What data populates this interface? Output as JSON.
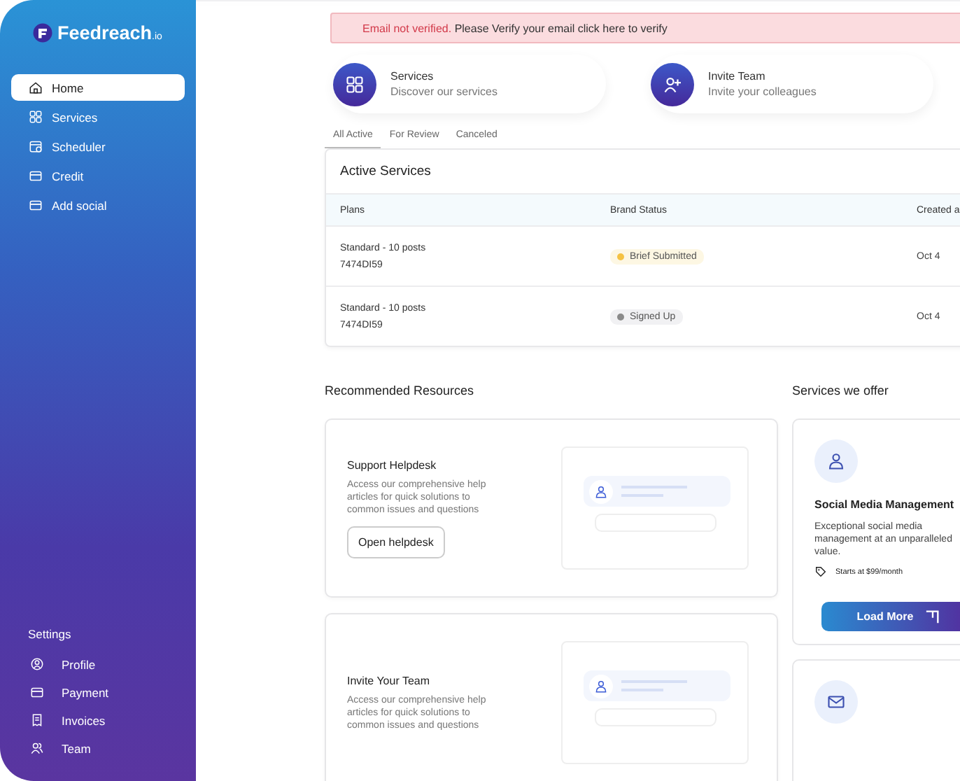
{
  "brand": {
    "name": "Feedreach",
    "suffix": ".io"
  },
  "nav": [
    {
      "label": "Home",
      "kind": "home",
      "selected": true
    },
    {
      "label": "Services",
      "kind": "grid",
      "selected": false
    },
    {
      "label": "Scheduler",
      "kind": "calendar",
      "selected": false
    },
    {
      "label": "Credit",
      "kind": "card",
      "selected": false
    },
    {
      "label": "Add social",
      "kind": "card",
      "selected": false
    }
  ],
  "settings": {
    "title": "Settings",
    "items": [
      {
        "label": "Profile",
        "kind": "profile"
      },
      {
        "label": "Payment",
        "kind": "payment"
      },
      {
        "label": "Invoices",
        "kind": "invoice"
      },
      {
        "label": "Team",
        "kind": "team"
      }
    ]
  },
  "alert": {
    "warning": "Email not verified.",
    "message": "Please Verify your email click here to verify"
  },
  "quick_cards": [
    {
      "title": "Services",
      "subtitle": "Discover our services",
      "kind": "grid"
    },
    {
      "title": "Invite Team",
      "subtitle": "Invite your colleagues",
      "kind": "add-user"
    }
  ],
  "tabs": [
    {
      "label": "All Active",
      "selected": true
    },
    {
      "label": "For Review",
      "selected": false
    },
    {
      "label": "Canceled",
      "selected": false
    }
  ],
  "table": {
    "title": "Active Services",
    "columns": [
      "Plans",
      "Brand Status",
      "Created a"
    ],
    "rows": [
      {
        "plan": "Standard - 10 posts",
        "code": "7474DI59",
        "status": "Brief Submitted",
        "color": "#f5c242",
        "created": "Oct 4"
      },
      {
        "plan": "Standard - 10 posts",
        "code": "7474DI59",
        "status": "Signed Up",
        "color": "#8a8a8a",
        "created": "Oct 4"
      }
    ]
  },
  "resources": {
    "title": "Recommended Resources",
    "cards": [
      {
        "title": "Support Helpdesk",
        "text": "Access our comprehensive help articles for quick solutions to common issues and questions",
        "button": "Open helpdesk"
      },
      {
        "title": "Invite Your Team",
        "text": "Access our comprehensive help articles for quick solutions to common issues and questions"
      }
    ]
  },
  "offers": {
    "title": "Services we offer",
    "cards": [
      {
        "kind": "person",
        "title": "Social Media Management",
        "text": "Exceptional social media management at an unparalleled value.",
        "price": "Starts at $99/month",
        "button": "Load More"
      },
      {
        "kind": "mail"
      }
    ]
  }
}
